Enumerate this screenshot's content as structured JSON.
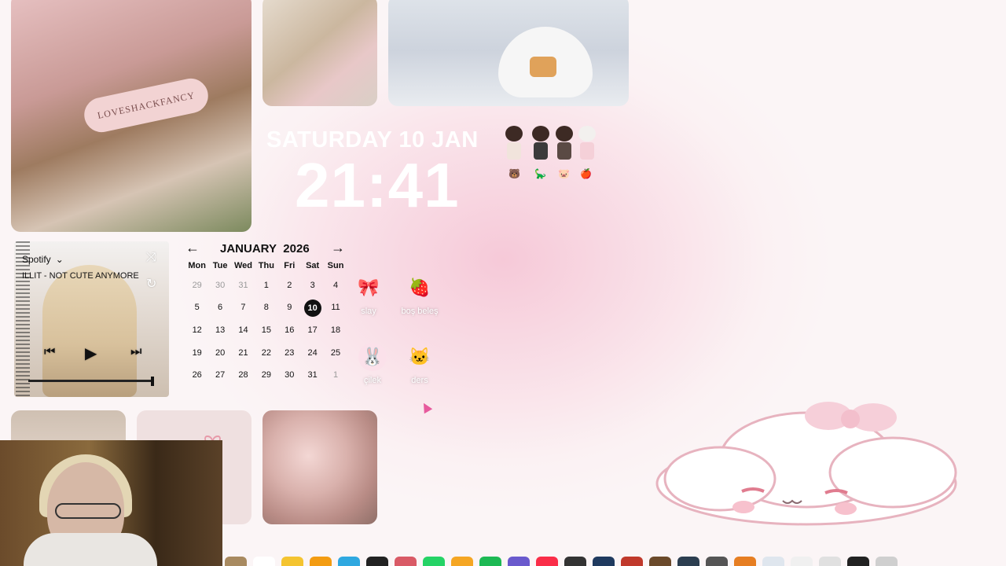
{
  "widgets": {
    "date": "SATURDAY  10 JAN",
    "time": "21:41"
  },
  "photos": {
    "shop_sign": "LOVESHACKFANCY"
  },
  "spotify": {
    "source": "Spotify",
    "track": "ILLIT - NOT CUTE ANYMORE"
  },
  "calendar": {
    "month": "JANUARY",
    "year": "2026",
    "weekdays": [
      "Mon",
      "Tue",
      "Wed",
      "Thu",
      "Fri",
      "Sat",
      "Sun"
    ],
    "weeks": [
      [
        "29",
        "30",
        "31",
        "1",
        "2",
        "3",
        "4"
      ],
      [
        "5",
        "6",
        "7",
        "8",
        "9",
        "10",
        "11"
      ],
      [
        "12",
        "13",
        "14",
        "15",
        "16",
        "17",
        "18"
      ],
      [
        "19",
        "20",
        "21",
        "22",
        "23",
        "24",
        "25"
      ],
      [
        "26",
        "27",
        "28",
        "29",
        "30",
        "31",
        "1"
      ]
    ]
  },
  "desktop_items": [
    {
      "label": "slay",
      "icon": "bow-icon"
    },
    {
      "label": "boş beleş",
      "icon": "strawberry-icon"
    },
    {
      "label": "çilek",
      "icon": "my-melody-icon"
    },
    {
      "label": "ders",
      "icon": "hello-kitty-icon"
    }
  ],
  "colors": {
    "accent_pink": "#f6c9d8",
    "background": "#fbf1f3",
    "today_highlight": "#111111"
  }
}
